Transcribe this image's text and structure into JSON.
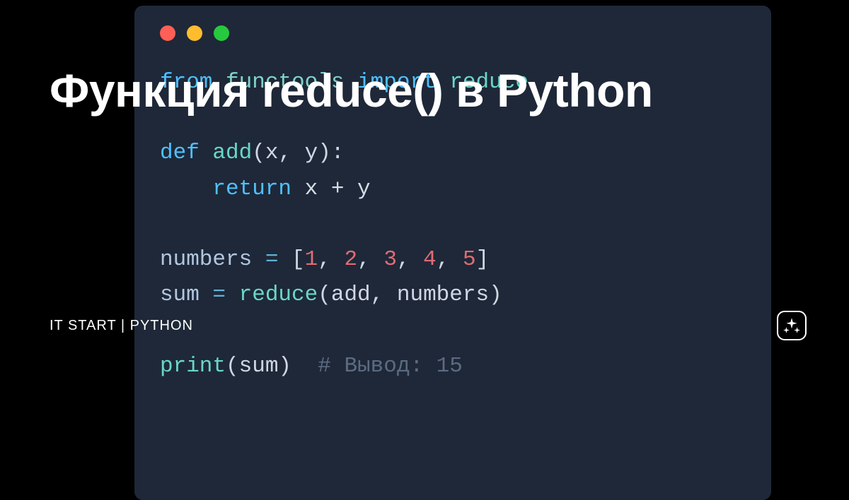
{
  "headline": "Функция reduce() в Python",
  "channel": "IT START | PYTHON",
  "code": {
    "line1": {
      "kw1": "from",
      "mod": "functools",
      "kw2": "import",
      "fn": "reduce"
    },
    "line2": {
      "kw": "def",
      "fn": "add",
      "params": "(x, y)",
      "colon": ":"
    },
    "line3": {
      "kw": "return",
      "expr": " x + y"
    },
    "line4": {
      "var": "numbers",
      "eq": " = ",
      "open": "[",
      "n1": "1",
      "c1": ", ",
      "n2": "2",
      "c2": ", ",
      "n3": "3",
      "c3": ", ",
      "n4": "4",
      "c4": ", ",
      "n5": "5",
      "close": "]"
    },
    "line5": {
      "var": "sum",
      "eq": " = ",
      "fn": "reduce",
      "args": "(add, numbers)"
    },
    "line6": {
      "fn": "print",
      "args": "(sum)",
      "sp": "  ",
      "comment": "# Вывод: 15"
    }
  }
}
